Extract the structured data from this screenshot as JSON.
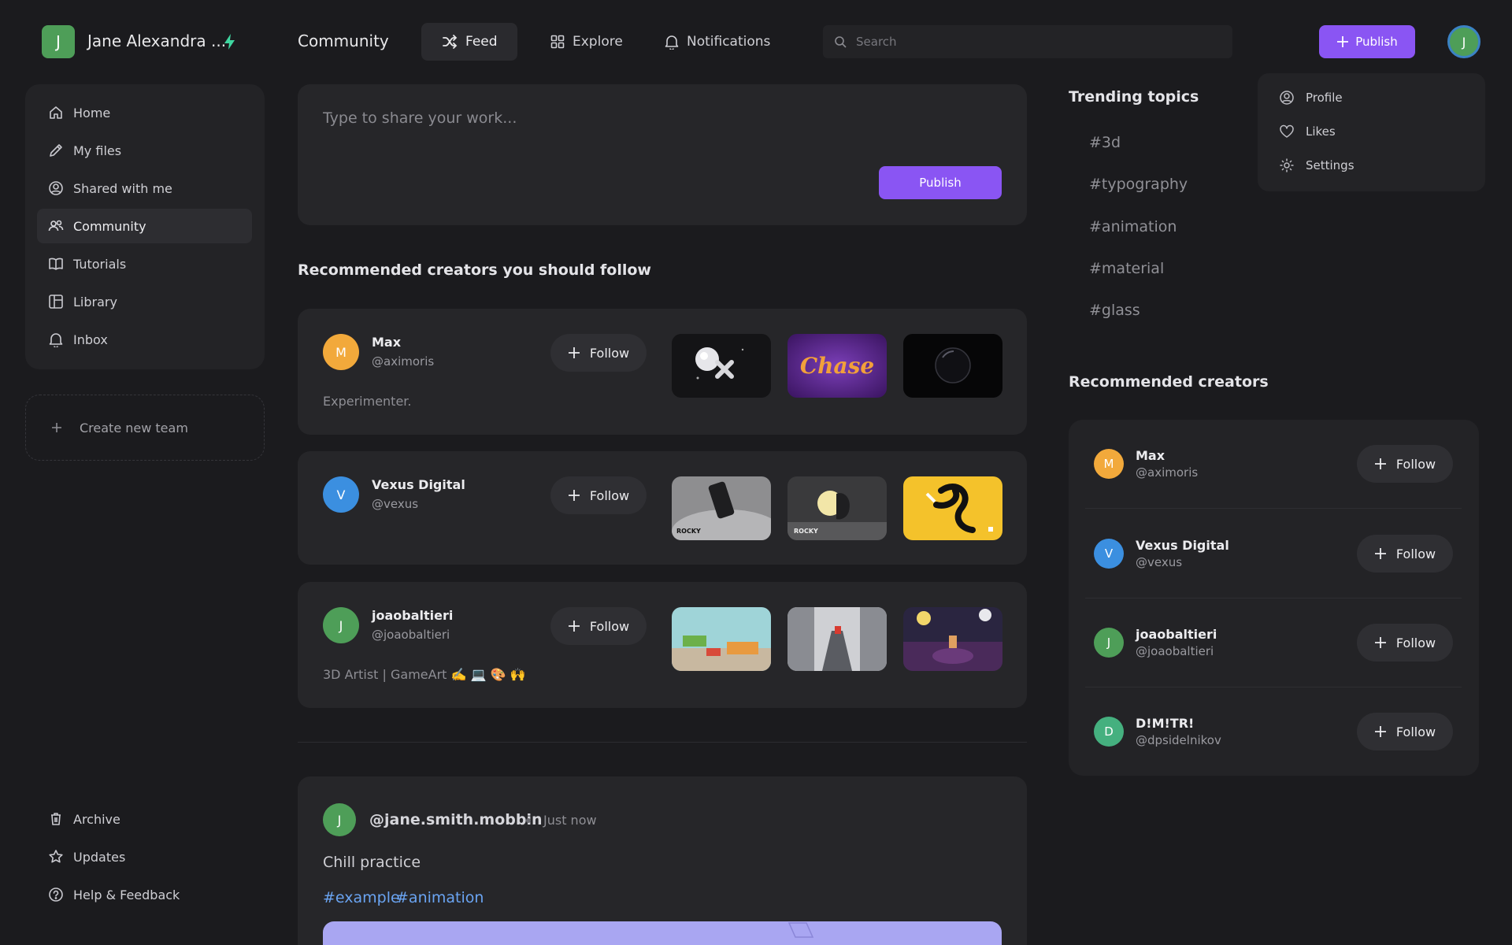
{
  "app": {
    "team_initial": "J",
    "team_name": "Jane Alexandra ...",
    "page_title": "Community"
  },
  "nav": {
    "tabs": [
      {
        "label": "Feed",
        "icon": "shuffle-icon"
      },
      {
        "label": "Explore",
        "icon": "grid-icon"
      },
      {
        "label": "Notifications",
        "icon": "bell-icon"
      }
    ]
  },
  "search": {
    "placeholder": "Search"
  },
  "header": {
    "publish_label": "Publish",
    "user_initial": "J"
  },
  "user_menu": {
    "items": [
      "Profile",
      "Likes",
      "Settings"
    ]
  },
  "sidebar": {
    "items": [
      {
        "label": "Home",
        "icon": "home-icon"
      },
      {
        "label": "My files",
        "icon": "pencil-icon"
      },
      {
        "label": "Shared with me",
        "icon": "user-circle-icon"
      },
      {
        "label": "Community",
        "icon": "users-icon"
      },
      {
        "label": "Tutorials",
        "icon": "book-icon"
      },
      {
        "label": "Library",
        "icon": "library-icon"
      },
      {
        "label": "Inbox",
        "icon": "bell-icon"
      }
    ],
    "create_team_label": "Create new team",
    "footer": [
      {
        "label": "Archive",
        "icon": "trash-icon"
      },
      {
        "label": "Updates",
        "icon": "star-icon"
      },
      {
        "label": "Help & Feedback",
        "icon": "help-icon"
      }
    ]
  },
  "composer": {
    "placeholder": "Type to share your work...",
    "publish_label": "Publish"
  },
  "recommended": {
    "title": "Recommended creators you should follow",
    "follow_label": "Follow",
    "creators": [
      {
        "initial": "M",
        "name": "Max",
        "handle": "@aximoris",
        "bio": "Experimenter.",
        "color": "#f2a93b"
      },
      {
        "initial": "V",
        "name": "Vexus Digital",
        "handle": "@vexus",
        "bio": "",
        "color": "#3b8fe0"
      },
      {
        "initial": "J",
        "name": "joaobaltieri",
        "handle": "@joaobaltieri",
        "bio": "3D Artist | GameArt ✍️ 💻 🎨 🙌",
        "color": "#4e9e58"
      }
    ]
  },
  "post": {
    "initial": "J",
    "author": "@jane.smith.mobbin",
    "time": "Just now",
    "text": "Chill practice",
    "tags": [
      "#example",
      "#animation"
    ]
  },
  "trending": {
    "title": "Trending topics",
    "topics": [
      "#3d",
      "#typography",
      "#animation",
      "#material",
      "#glass"
    ]
  },
  "right_creators": {
    "title": "Recommended creators",
    "follow_label": "Follow",
    "creators": [
      {
        "initial": "M",
        "name": "Max",
        "handle": "@aximoris",
        "color": "#f2a93b"
      },
      {
        "initial": "V",
        "name": "Vexus Digital",
        "handle": "@vexus",
        "color": "#3b8fe0"
      },
      {
        "initial": "J",
        "name": "joaobaltieri",
        "handle": "@joaobaltieri",
        "color": "#4e9e58"
      },
      {
        "initial": "D",
        "name": "D!M!TR!",
        "handle": "@dpsidelnikov",
        "color": "#45b07f"
      }
    ]
  },
  "colors": {
    "accent": "#8a55f3",
    "background": "#1b1b1e",
    "card": "#262629",
    "link": "#6aa4f2"
  }
}
